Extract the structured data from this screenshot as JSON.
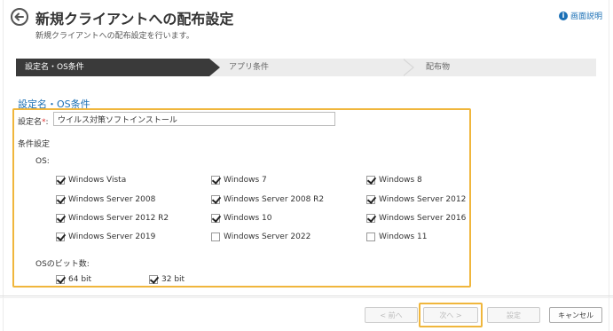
{
  "header": {
    "title": "新規クライアントへの配布設定",
    "subtitle": "新規クライアントへの配布設定を行います。",
    "help_label": "画面説明"
  },
  "steps": [
    {
      "label": "設定名・OS条件"
    },
    {
      "label": "アプリ条件"
    },
    {
      "label": "配布物"
    }
  ],
  "section": {
    "title": "設定名・OS条件",
    "name_label": "設定名",
    "required_mark": "*",
    "name_colon": ":",
    "name_value": "ウイルス対策ソフトインストール",
    "conditions_label": "条件設定",
    "os_label": "OS:",
    "os_options": [
      {
        "label": "Windows Vista",
        "checked": true
      },
      {
        "label": "Windows 7",
        "checked": true
      },
      {
        "label": "Windows 8",
        "checked": true
      },
      {
        "label": "Windows Server 2008",
        "checked": true
      },
      {
        "label": "Windows Server 2008 R2",
        "checked": true
      },
      {
        "label": "Windows Server 2012",
        "checked": true
      },
      {
        "label": "Windows Server 2012 R2",
        "checked": true
      },
      {
        "label": "Windows 10",
        "checked": true
      },
      {
        "label": "Windows Server 2016",
        "checked": true
      },
      {
        "label": "Windows Server 2019",
        "checked": true
      },
      {
        "label": "Windows Server 2022",
        "checked": false
      },
      {
        "label": "Windows 11",
        "checked": false
      }
    ],
    "bit_label": "OSのビット数:",
    "bit_options": [
      {
        "label": "64 bit",
        "checked": true
      },
      {
        "label": "32 bit",
        "checked": true
      }
    ]
  },
  "footer": {
    "prev_label": "< 前へ",
    "next_label": "次へ >",
    "settings_label": "設定",
    "cancel_label": "キャンセル"
  },
  "colors": {
    "accent": "#1a6fb5",
    "highlight": "#f0b63c",
    "active_step": "#3a3a3a"
  }
}
